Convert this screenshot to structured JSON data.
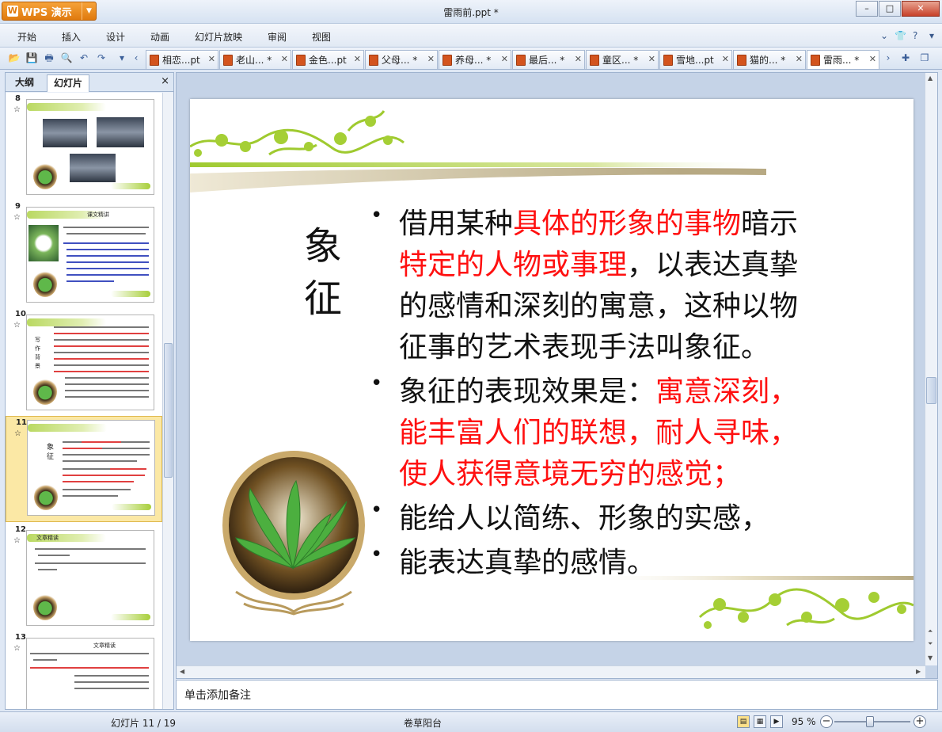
{
  "app": {
    "name": "WPS 演示",
    "window_title": "雷雨前.ppt *",
    "win_controls": {
      "minimize": "–",
      "maximize": "□",
      "close": "✕"
    }
  },
  "menu": {
    "items": [
      "开始",
      "插入",
      "设计",
      "动画",
      "幻灯片放映",
      "审阅",
      "视图"
    ],
    "right_icons": [
      "shirt-icon",
      "help-icon"
    ]
  },
  "doc_tabs": [
    {
      "label": "相恋...pt",
      "active": false
    },
    {
      "label": "老山... *",
      "active": false
    },
    {
      "label": "金色...pt",
      "active": false
    },
    {
      "label": "父母... *",
      "active": false
    },
    {
      "label": "养母... *",
      "active": false
    },
    {
      "label": "最后... *",
      "active": false
    },
    {
      "label": "童区... *",
      "active": false
    },
    {
      "label": "雪地...pt",
      "active": false
    },
    {
      "label": "猫的... *",
      "active": false
    },
    {
      "label": "雷雨... *",
      "active": true
    }
  ],
  "left_panel": {
    "tab_outline": "大纲",
    "tab_slides": "幻灯片",
    "close": "×",
    "slides": [
      {
        "num": "8",
        "star": "☆"
      },
      {
        "num": "9",
        "star": "☆",
        "thumb_title": "课文精讲"
      },
      {
        "num": "10",
        "star": "☆",
        "thumb_side": "写作背景"
      },
      {
        "num": "11",
        "star": "☆",
        "selected": true,
        "thumb_side": "象征"
      },
      {
        "num": "12",
        "star": "☆",
        "thumb_title": "文章精读"
      },
      {
        "num": "13",
        "star": "☆",
        "thumb_title": "文章精读"
      }
    ]
  },
  "slide": {
    "title_chars": [
      "象",
      "征"
    ],
    "bullets": [
      {
        "lines": [
          [
            {
              "t": "借用某种",
              "red": false
            },
            {
              "t": "具体的形象的事物",
              "red": true
            },
            {
              "t": "暗示",
              "red": false
            }
          ],
          [
            {
              "t": "特定的人物或事理",
              "red": true
            },
            {
              "t": "，以表达真挚",
              "red": false
            }
          ],
          [
            {
              "t": "的感情和深刻的寓意，这种以物",
              "red": false
            }
          ],
          [
            {
              "t": "征事的艺术表现手法叫象征。",
              "red": false
            }
          ]
        ]
      },
      {
        "lines": [
          [
            {
              "t": "象征的表现效果是：",
              "red": false
            },
            {
              "t": "寓意深刻，",
              "red": true
            }
          ],
          [
            {
              "t": "能丰富人们的联想，耐人寻味，",
              "red": true
            }
          ],
          [
            {
              "t": "使人获得意境无穷的感觉；",
              "red": true
            }
          ]
        ]
      },
      {
        "lines": [
          [
            {
              "t": "能给人以简练、形象的实感，",
              "red": false
            }
          ]
        ]
      },
      {
        "lines": [
          [
            {
              "t": "能表达真挚的感情。",
              "red": false
            }
          ]
        ]
      }
    ]
  },
  "notes_placeholder": "单击添加备注",
  "status": {
    "slide_counter": "幻灯片 11 / 19",
    "theme_name": "卷草阳台",
    "zoom": "95 %",
    "zoom_out": "−",
    "zoom_in": "+"
  },
  "colors": {
    "accent_red": "#ff1010",
    "wps_orange": "#e07a0e",
    "vine_green": "#a8cf3a"
  }
}
